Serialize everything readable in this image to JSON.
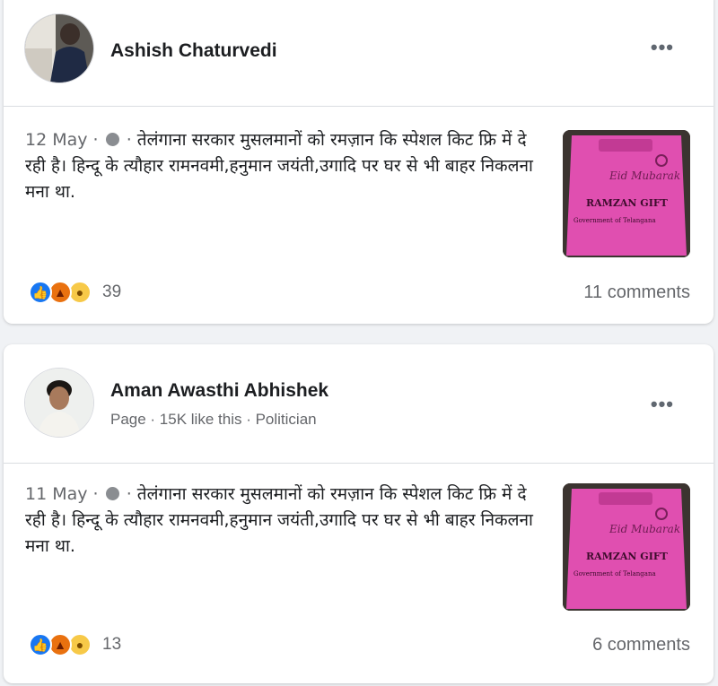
{
  "colors": {
    "page_bg": "#f0f2f5",
    "card_bg": "#ffffff",
    "text_primary": "#1c1e21",
    "text_secondary": "#65676b",
    "like_blue": "#1877f2",
    "bag_pink": "#e04fb0"
  },
  "posts": [
    {
      "author": "Ashish Chaturvedi",
      "subline": "",
      "more_label": "•••",
      "date": "12 May",
      "separator": "·",
      "privacy_icon": "globe-icon",
      "text": "तेलंगाना सरकार मुसलमानों को रमज़ान कि स्पेशल किट फ्रि में दे रही है। हिन्दू के त्यौहार रामनवमी,हनुमान जयंती,उगादि पर घर से भी बाहर निकलना मना था.",
      "image_text": [
        "Eid Mubarak",
        "RAMZAN GIFT",
        "Government of Telangana"
      ],
      "reactions": [
        "like-icon",
        "angry-icon",
        "sad-icon"
      ],
      "reaction_count": "39",
      "comments": "11 comments"
    },
    {
      "author": "Aman Awasthi Abhishek",
      "subline": "Page · 15K like this · Politician",
      "more_label": "•••",
      "date": "11 May",
      "separator": "·",
      "privacy_icon": "globe-icon",
      "text": "तेलंगाना सरकार मुसलमानों को रमज़ान कि स्पेशल किट फ्रि में दे रही है। हिन्दू के त्यौहार रामनवमी,हनुमान जयंती,उगादि पर घर से भी बाहर निकलना मना था.",
      "image_text": [
        "Eid Mubarak",
        "RAMZAN GIFT",
        "Government of Telangana"
      ],
      "reactions": [
        "like-icon",
        "angry-icon",
        "sad-icon"
      ],
      "reaction_count": "13",
      "comments": "6 comments"
    }
  ]
}
